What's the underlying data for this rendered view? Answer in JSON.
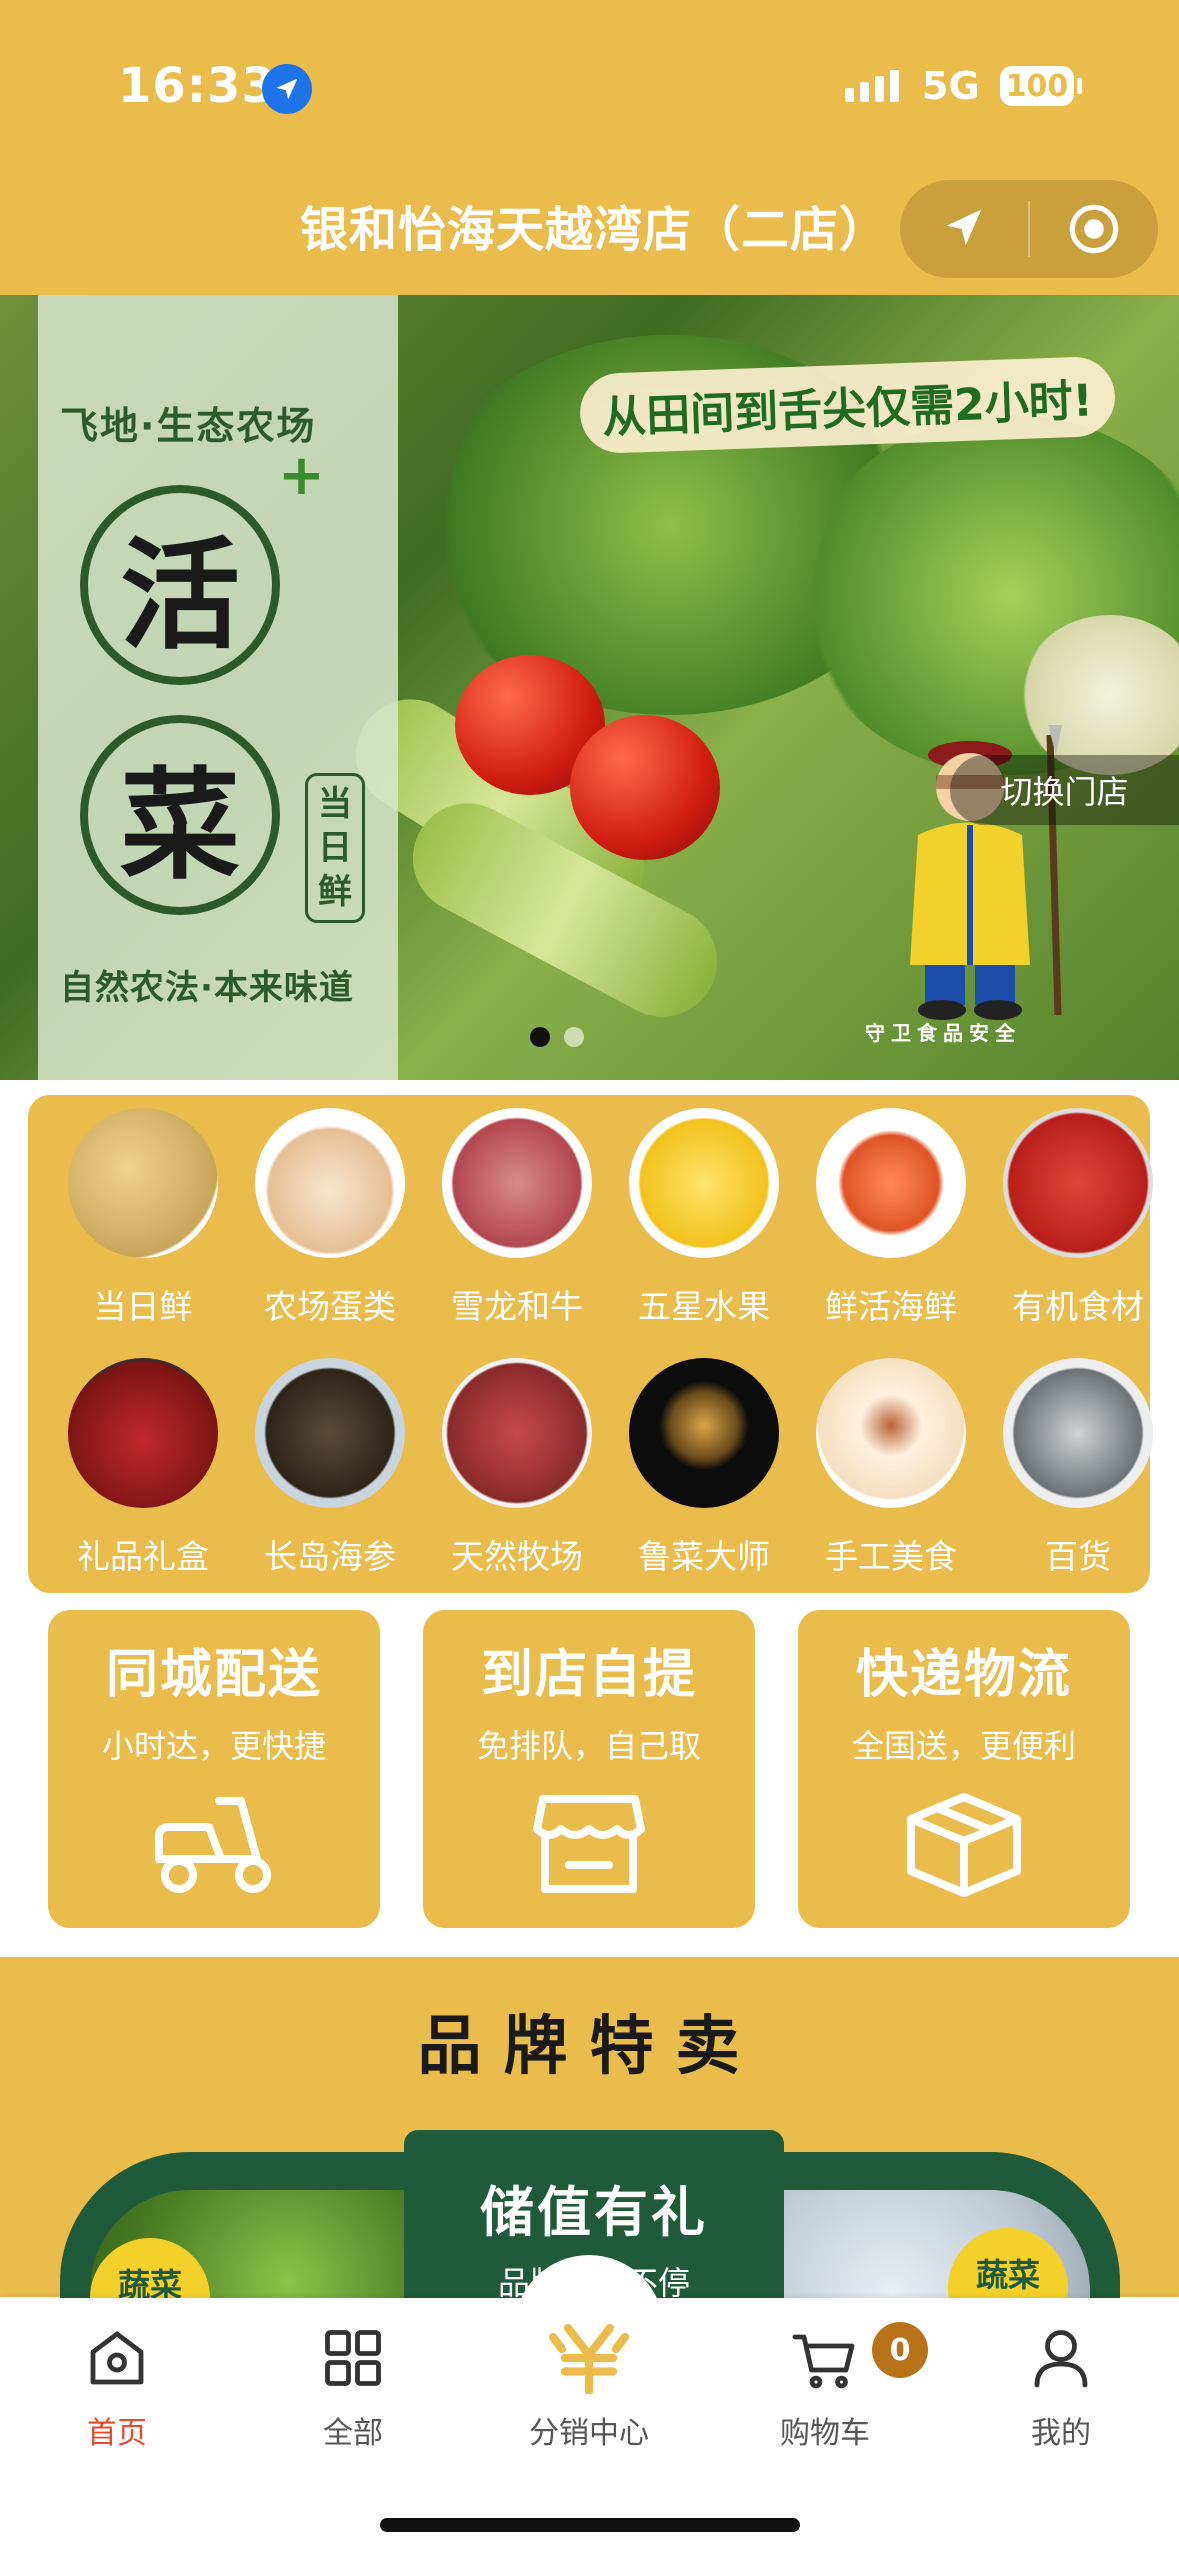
{
  "status_bar": {
    "time": "16:33",
    "network": "5G",
    "battery": "100"
  },
  "header": {
    "store_name": "银和怡海天越湾店（二店）"
  },
  "banner": {
    "brand_line": "飞地·生态农场",
    "plus": "+",
    "big_char_1": "活",
    "big_char_2": "菜",
    "fresh_tag": [
      "当",
      "日",
      "鲜"
    ],
    "slogan": "自然农法·本来味道",
    "headline": "从田间到舌尖仅需2小时!",
    "switch_store": "切换门店",
    "guard_caption": "守卫食品安全",
    "page_count": 2,
    "active_page": 0
  },
  "categories": [
    {
      "label": "当日鲜",
      "icon": "potato-image"
    },
    {
      "label": "农场蛋类",
      "icon": "eggs-image"
    },
    {
      "label": "雪龙和牛",
      "icon": "beef-image"
    },
    {
      "label": "五星水果",
      "icon": "pineapple-image"
    },
    {
      "label": "鲜活海鲜",
      "icon": "shrimp-image"
    },
    {
      "label": "有机食材",
      "icon": "goji-image"
    },
    {
      "label": "礼品礼盒",
      "icon": "giftbox-image"
    },
    {
      "label": "长岛海参",
      "icon": "sea-cucumber-image"
    },
    {
      "label": "天然牧场",
      "icon": "meat-image"
    },
    {
      "label": "鲁菜大师",
      "icon": "dish-image"
    },
    {
      "label": "手工美食",
      "icon": "bun-image"
    },
    {
      "label": "百货",
      "icon": "cookware-image"
    }
  ],
  "delivery": [
    {
      "title": "同城配送",
      "subtitle": "小时达，更快捷",
      "icon": "scooter-icon"
    },
    {
      "title": "到店自提",
      "subtitle": "免排队，自己取",
      "icon": "store-icon"
    },
    {
      "title": "快递物流",
      "subtitle": "全国送，更便利",
      "icon": "box-icon"
    }
  ],
  "brand_section": {
    "title": "品牌特卖",
    "promo_title": "储值有礼",
    "promo_subtitle": "品牌特卖不停",
    "left_tag": "蔬菜",
    "right_tag": "蔬菜"
  },
  "tabbar": {
    "tabs": [
      {
        "label": "首页",
        "icon": "home-icon",
        "active": true
      },
      {
        "label": "全部",
        "icon": "grid-icon",
        "active": false
      },
      {
        "label": "分销中心",
        "icon": "yuan-icon",
        "active": false
      },
      {
        "label": "购物车",
        "icon": "cart-icon",
        "active": false
      },
      {
        "label": "我的",
        "icon": "user-icon",
        "active": false
      }
    ],
    "cart_count": "0"
  },
  "colors": {
    "theme_yellow": "#E9BC4C",
    "active_red": "#E84A2E",
    "dark_green": "#1F5A3A"
  }
}
